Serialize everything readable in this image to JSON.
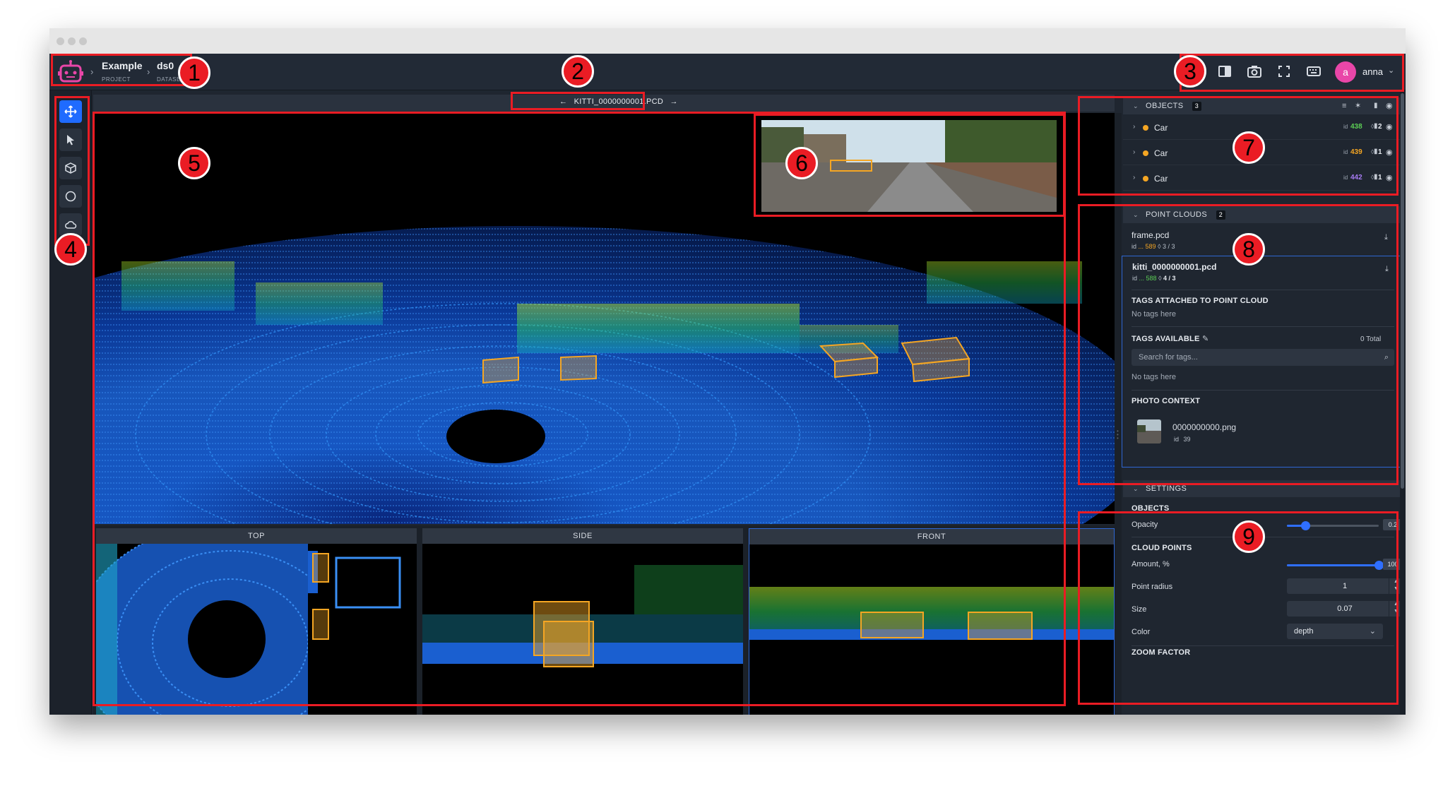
{
  "breadcrumb": {
    "project": {
      "name": "Example",
      "type": "PROJECT"
    },
    "dataset": {
      "name": "ds0",
      "type": "DATASET"
    }
  },
  "user": {
    "name": "anna",
    "initial": "a"
  },
  "topbar_icons": [
    "panel-toggle-icon",
    "camera-icon",
    "fullscreen-icon",
    "keyboard-icon"
  ],
  "tools": [
    "move-icon",
    "pointer-icon",
    "cuboid-icon",
    "circle-icon",
    "cloud-icon"
  ],
  "file_nav": {
    "prev": "←",
    "filename": "KITTI_0000000001.PCD",
    "next": "→"
  },
  "views": [
    "TOP",
    "SIDE",
    "FRONT"
  ],
  "objects": {
    "title": "OBJECTS",
    "count": "3",
    "items": [
      {
        "name": "Car",
        "id_label": "id",
        "id": "438",
        "id_color": "#5ccf55",
        "figures": "2"
      },
      {
        "name": "Car",
        "id_label": "id",
        "id": "439",
        "id_color": "#f5a623",
        "figures": "1"
      },
      {
        "name": "Car",
        "id_label": "id",
        "id": "442",
        "id_color": "#a77bf3",
        "figures": "1"
      }
    ]
  },
  "point_clouds": {
    "title": "POINT CLOUDS",
    "count": "2",
    "items": [
      {
        "name": "frame.pcd",
        "id_label": "id",
        "id": "... 589",
        "id_color": "#f5a623",
        "figures": "3 / 3"
      },
      {
        "name": "kitti_0000000001.pcd",
        "id_label": "id",
        "id": "... 588",
        "id_color": "#5ccf55",
        "figures": "4 / 3"
      }
    ],
    "tags_attached_title": "TAGS ATTACHED TO POINT CLOUD",
    "tags_attached_empty": "No tags here",
    "tags_available_title": "TAGS AVAILABLE",
    "tags_total": "0 Total",
    "tags_search_placeholder": "Search for tags...",
    "tags_available_empty": "No tags here",
    "photo_context_title": "PHOTO CONTEXT",
    "photo": {
      "name": "0000000000.png",
      "id_label": "id",
      "id": "39"
    }
  },
  "settings": {
    "title": "SETTINGS",
    "objects_title": "OBJECTS",
    "opacity_label": "Opacity",
    "opacity_value": "0.2",
    "opacity_fraction": 0.2,
    "cloud_points_title": "CLOUD POINTS",
    "amount_label": "Amount, %",
    "amount_value": "100",
    "amount_fraction": 1.0,
    "point_radius_label": "Point radius",
    "point_radius_value": "1",
    "size_label": "Size",
    "size_value": "0.07",
    "color_label": "Color",
    "color_value": "depth",
    "zoom_title": "ZOOM FACTOR"
  },
  "markers": [
    "1",
    "2",
    "3",
    "4",
    "5",
    "6",
    "7",
    "8",
    "9"
  ],
  "colors": {
    "accent": "#1f6bff",
    "annotation": "#ea1c24",
    "cuboid": "#f5a623"
  }
}
